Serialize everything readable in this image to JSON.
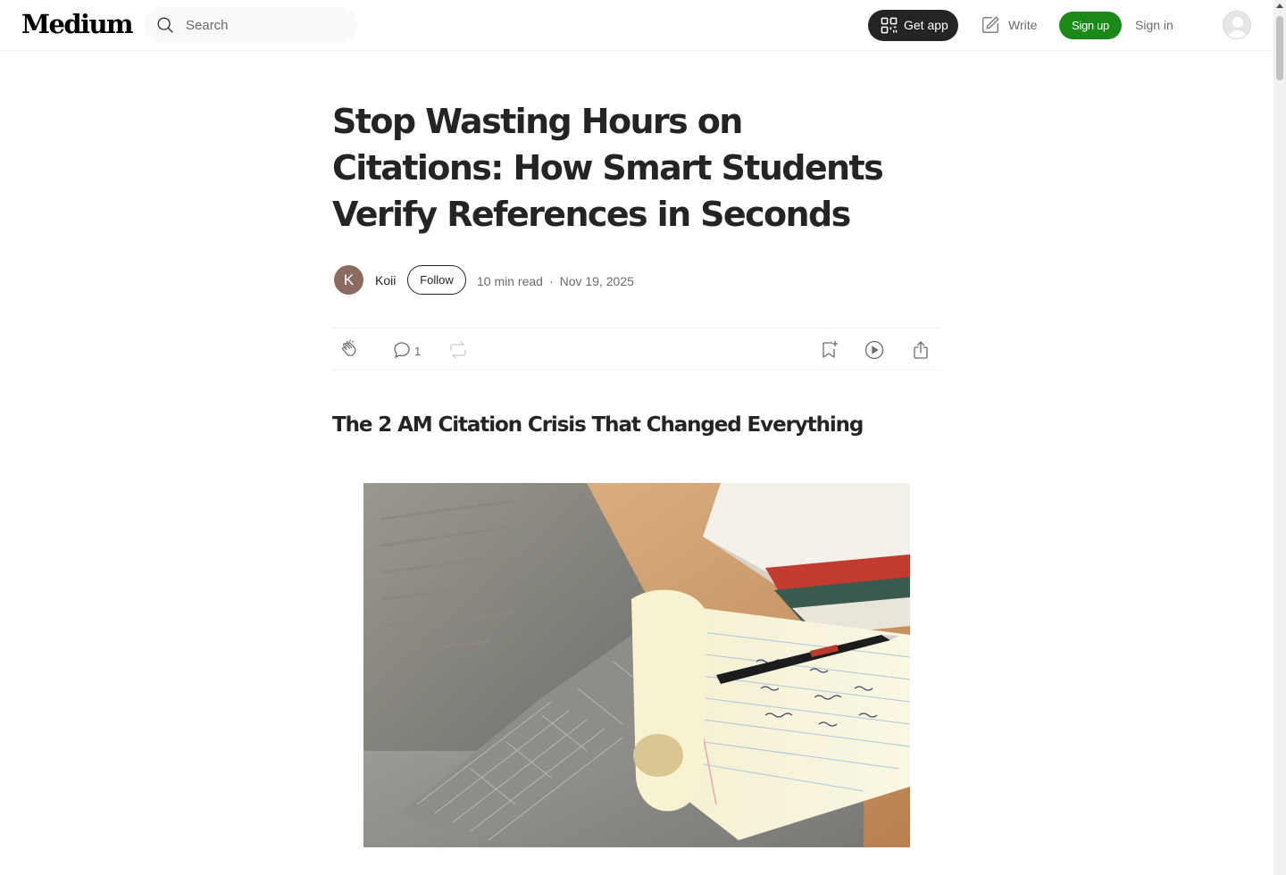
{
  "nav": {
    "logo": "Medium",
    "search_placeholder": "Search",
    "get_app": "Get app",
    "write": "Write",
    "sign_up": "Sign up",
    "sign_in": "Sign in"
  },
  "article": {
    "title": "Stop Wasting Hours on Citations: How Smart Students Verify References in Seconds",
    "author_initial": "K",
    "author_name": "Koii",
    "follow": "Follow",
    "read_time": "10 min read",
    "separator": "·",
    "date": "Nov 19, 2025",
    "comment_count": "1",
    "section_heading": "The 2 AM Citation Crisis That Changed Everything"
  },
  "colors": {
    "brand_green": "#1a8917",
    "dark": "#242424",
    "muted": "#6b6b6b"
  },
  "icons": [
    "search-icon",
    "qr-code-icon",
    "write-icon",
    "user-avatar-icon",
    "clap-icon",
    "comment-icon",
    "repost-icon",
    "bookmark-icon",
    "listen-icon",
    "share-icon"
  ]
}
